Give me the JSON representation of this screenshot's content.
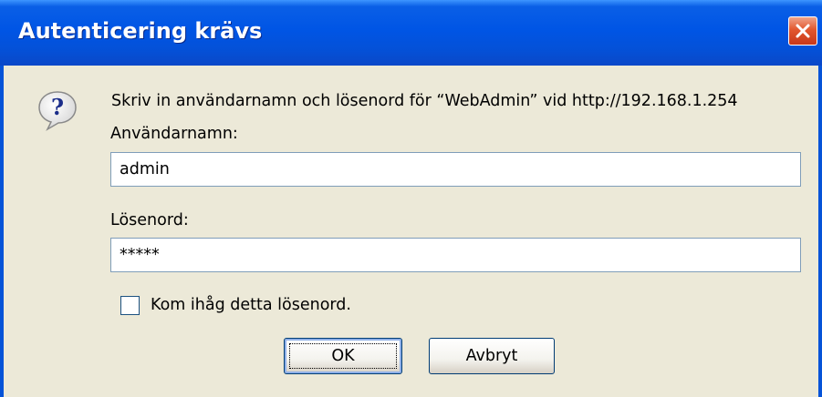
{
  "window": {
    "title": "Autenticering krävs",
    "close_icon": "close-icon"
  },
  "dialog": {
    "icon": "question-icon",
    "prompt": "Skriv in användarnamn och lösenord för “WebAdmin” vid http://192.168.1.254",
    "username_label": "Användarnamn:",
    "username_value": "admin",
    "password_label": "Lösenord:",
    "password_value": "*****",
    "remember_label": "Kom ihåg detta lösenord.",
    "remember_checked": false,
    "ok_label": "OK",
    "cancel_label": "Avbryt"
  },
  "colors": {
    "titlebar": "#0055e5",
    "dialog_bg": "#ece9d8",
    "close_button": "#e2572e"
  }
}
